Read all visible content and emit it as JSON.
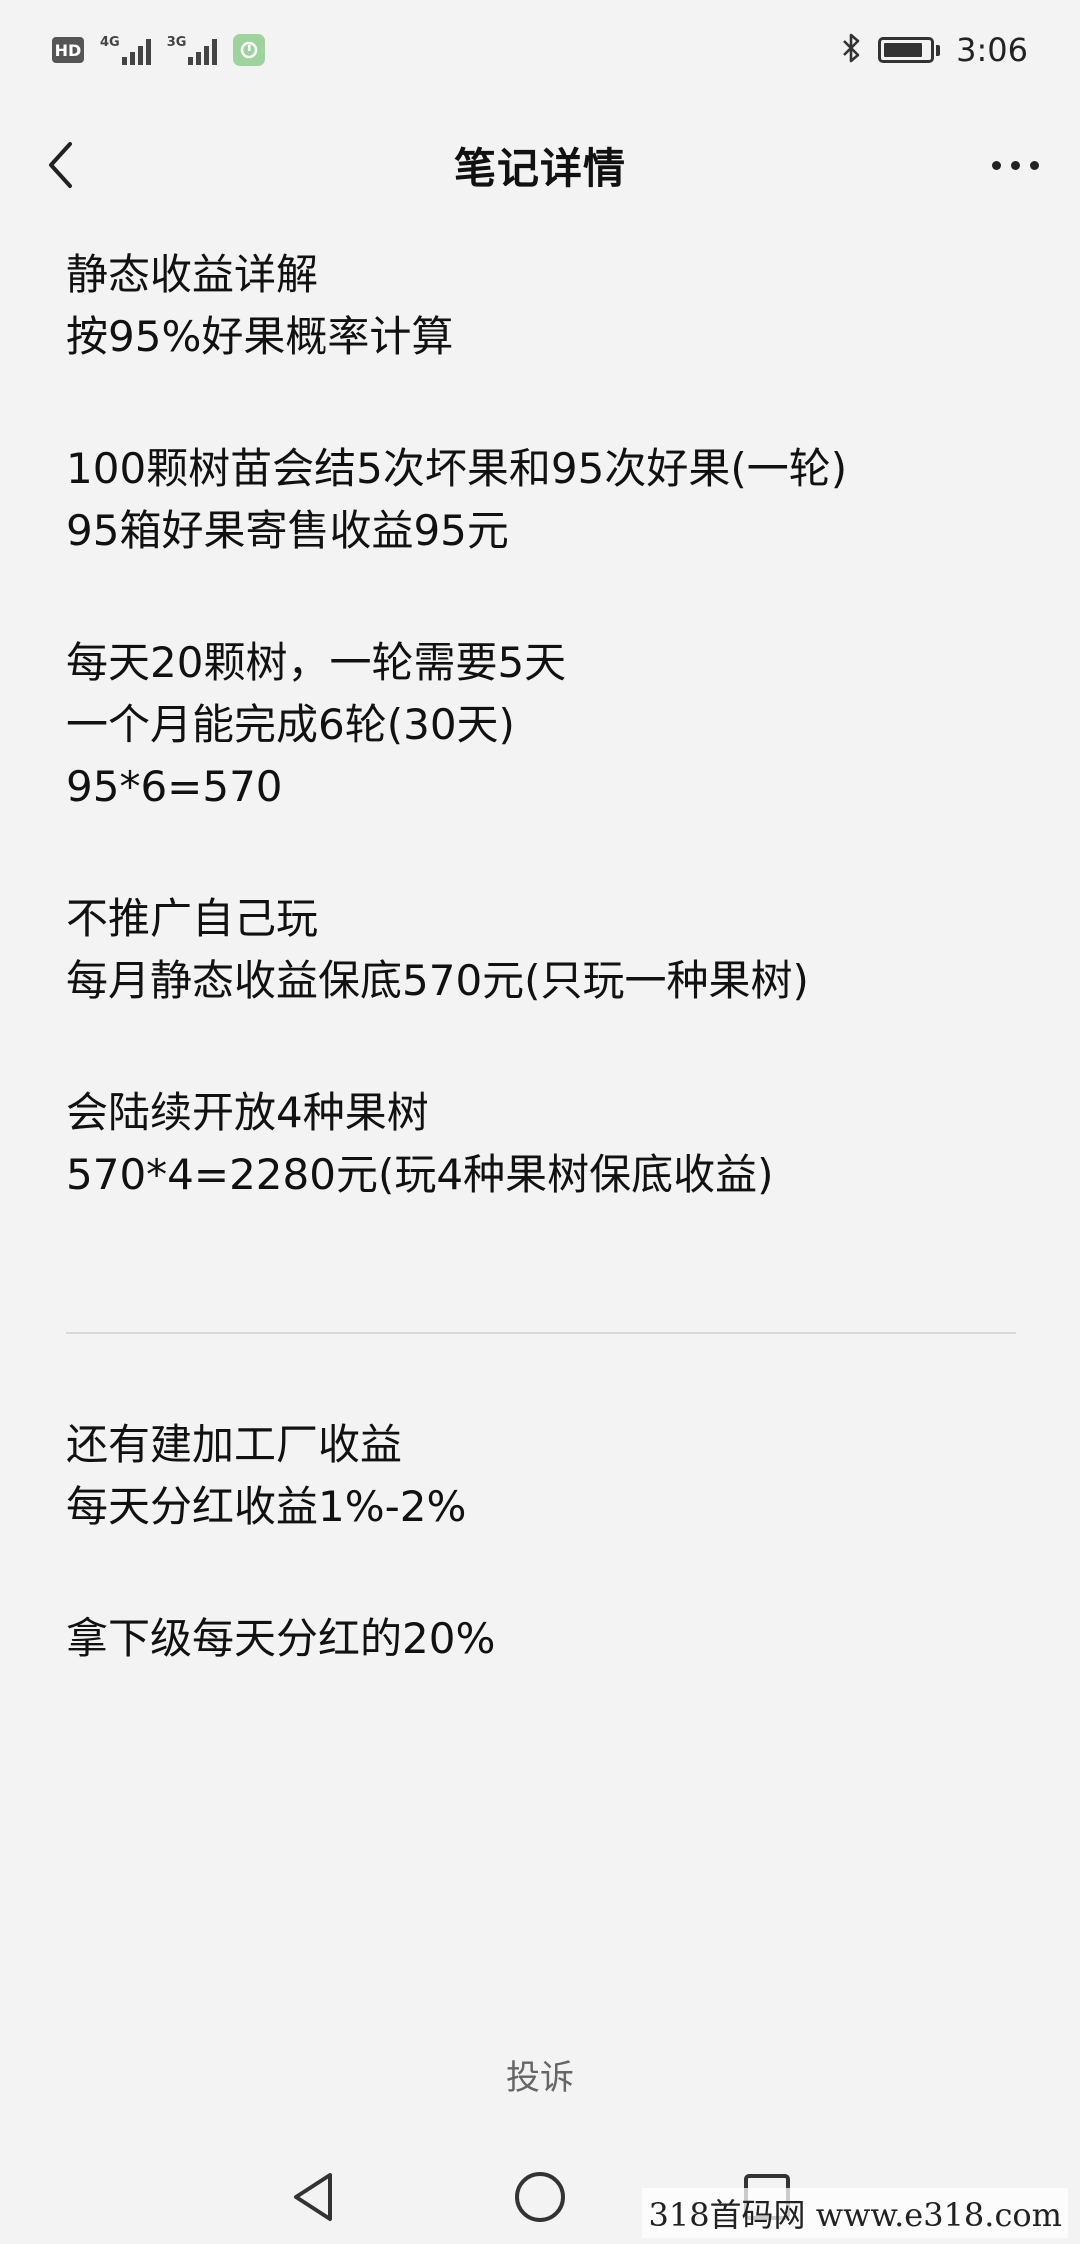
{
  "status_bar": {
    "hd_label": "HD",
    "net1_label": "4G",
    "net2_label": "3G",
    "time": "3:06"
  },
  "header": {
    "title": "笔记详情"
  },
  "note": {
    "paragraphs": [
      [
        "静态收益详解",
        "按95%好果概率计算"
      ],
      [
        "100颗树苗会结5次坏果和95次好果(一轮)",
        "95箱好果寄售收益95元"
      ],
      [
        "每天20颗树，一轮需要5天",
        "一个月能完成6轮(30天)",
        "95*6=570"
      ],
      [
        "不推广自己玩",
        "每月静态收益保底570元(只玩一种果树)"
      ],
      [
        "会陆续开放4种果树",
        "570*4=2280元(玩4种果树保底收益)"
      ]
    ],
    "after_divider": [
      [
        "还有建加工厂收益",
        "每天分红收益1%-2%"
      ],
      [
        "拿下级每天分红的20%"
      ]
    ]
  },
  "footer": {
    "report_label": "投诉"
  },
  "watermark": "318首码网 www.e318.com",
  "colors": {
    "background": "#f3f3f3",
    "text": "#111111",
    "muted": "#666666",
    "divider": "#d8d8d8"
  }
}
